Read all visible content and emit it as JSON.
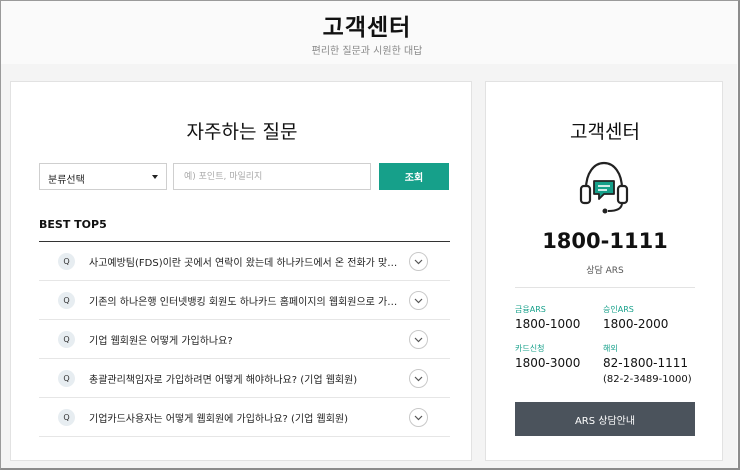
{
  "header": {
    "title": "고객센터",
    "subtitle": "편리한 질문과 시원한 대답"
  },
  "faq": {
    "title": "자주하는 질문",
    "category_select": {
      "selected": "분류선택"
    },
    "search": {
      "placeholder": "예) 포인트, 마일리지"
    },
    "search_button_label": "조회",
    "best_label": "BEST TOP5",
    "q_badge": "Q",
    "items": [
      {
        "question": "사고예방팀(FDS)이란 곳에서 연락이 왔는데 하나카드에서 온 전화가 맞나요?"
      },
      {
        "question": "기존의 하나은행 인터넷뱅킹 회원도 하나카드 홈페이지의 웹회원으로 가입해야 하나요?"
      },
      {
        "question": "기업 웹회원은 어떻게 가입하나요?"
      },
      {
        "question": "총괄관리책임자로 가입하려면 어떻게 해야하나요? (기업 웹회원)"
      },
      {
        "question": "기업카드사용자는 어떻게 웹회원에 가입하나요? (기업 웹회원)"
      }
    ]
  },
  "customer_center": {
    "title": "고객센터",
    "icon": "headset-chat-icon",
    "main_phone": "1800-1111",
    "main_phone_label": "상담 ARS",
    "lines": [
      {
        "label": "금융ARS",
        "number": "1800-1000"
      },
      {
        "label": "승인ARS",
        "number": "1800-2000"
      },
      {
        "label": "카드신청",
        "number": "1800-3000"
      },
      {
        "label": "해외",
        "number": "82-1800-1111",
        "note": "(82-2-3489-1000)"
      }
    ],
    "ars_button_label": "ARS 상담안내"
  },
  "colors": {
    "accent": "#16a08a",
    "button_dark": "#4b535c",
    "background": "#f4f4f4"
  }
}
